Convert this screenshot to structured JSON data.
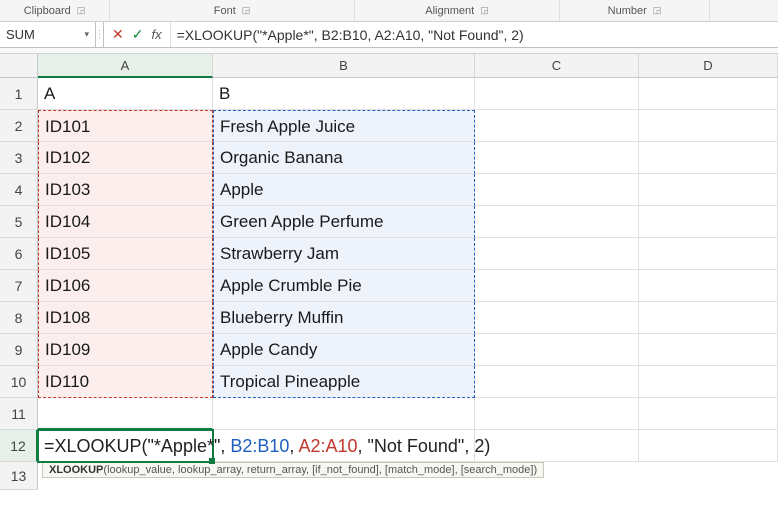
{
  "ribbon": {
    "groups": [
      "Clipboard",
      "Font",
      "Alignment",
      "Number"
    ]
  },
  "nameBox": {
    "value": "SUM"
  },
  "formulaBar": {
    "cancelGlyph": "✕",
    "enterGlyph": "✓",
    "fxLabel": "fx",
    "text": "=XLOOKUP(\"*Apple*\", B2:B10, A2:A10, \"Not Found\", 2)"
  },
  "columns": [
    "A",
    "B",
    "C",
    "D"
  ],
  "rows": [
    "1",
    "2",
    "3",
    "4",
    "5",
    "6",
    "7",
    "8",
    "9",
    "10",
    "11",
    "12",
    "13"
  ],
  "cells": {
    "A1": "A",
    "B1": "B",
    "A2": "ID101",
    "B2": "Fresh Apple Juice",
    "A3": "ID102",
    "B3": "Organic Banana",
    "A4": "ID103",
    "B4": "Apple",
    "A5": "ID104",
    "B5": "Green Apple Perfume",
    "A6": "ID105",
    "B6": "Strawberry Jam",
    "A7": "ID106",
    "B7": "Apple Crumble Pie",
    "A8": "ID108",
    "B8": "Blueberry Muffin",
    "A9": "ID109",
    "B9": "Apple Candy",
    "A10": "ID110",
    "B10": "Tropical Pineapple"
  },
  "editing": {
    "cellRef": "A12",
    "parts": {
      "p1": "=XLOOKUP(\"*Apple*\", ",
      "p2": "B2:B10",
      "p3": ", ",
      "p4": "A2:A10",
      "p5": ", \"Not Found\", 2)"
    }
  },
  "tooltip": {
    "funcName": "XLOOKUP",
    "sig": "(lookup_value, lookup_array, return_array, [if_not_found], [match_mode], [search_mode])"
  }
}
